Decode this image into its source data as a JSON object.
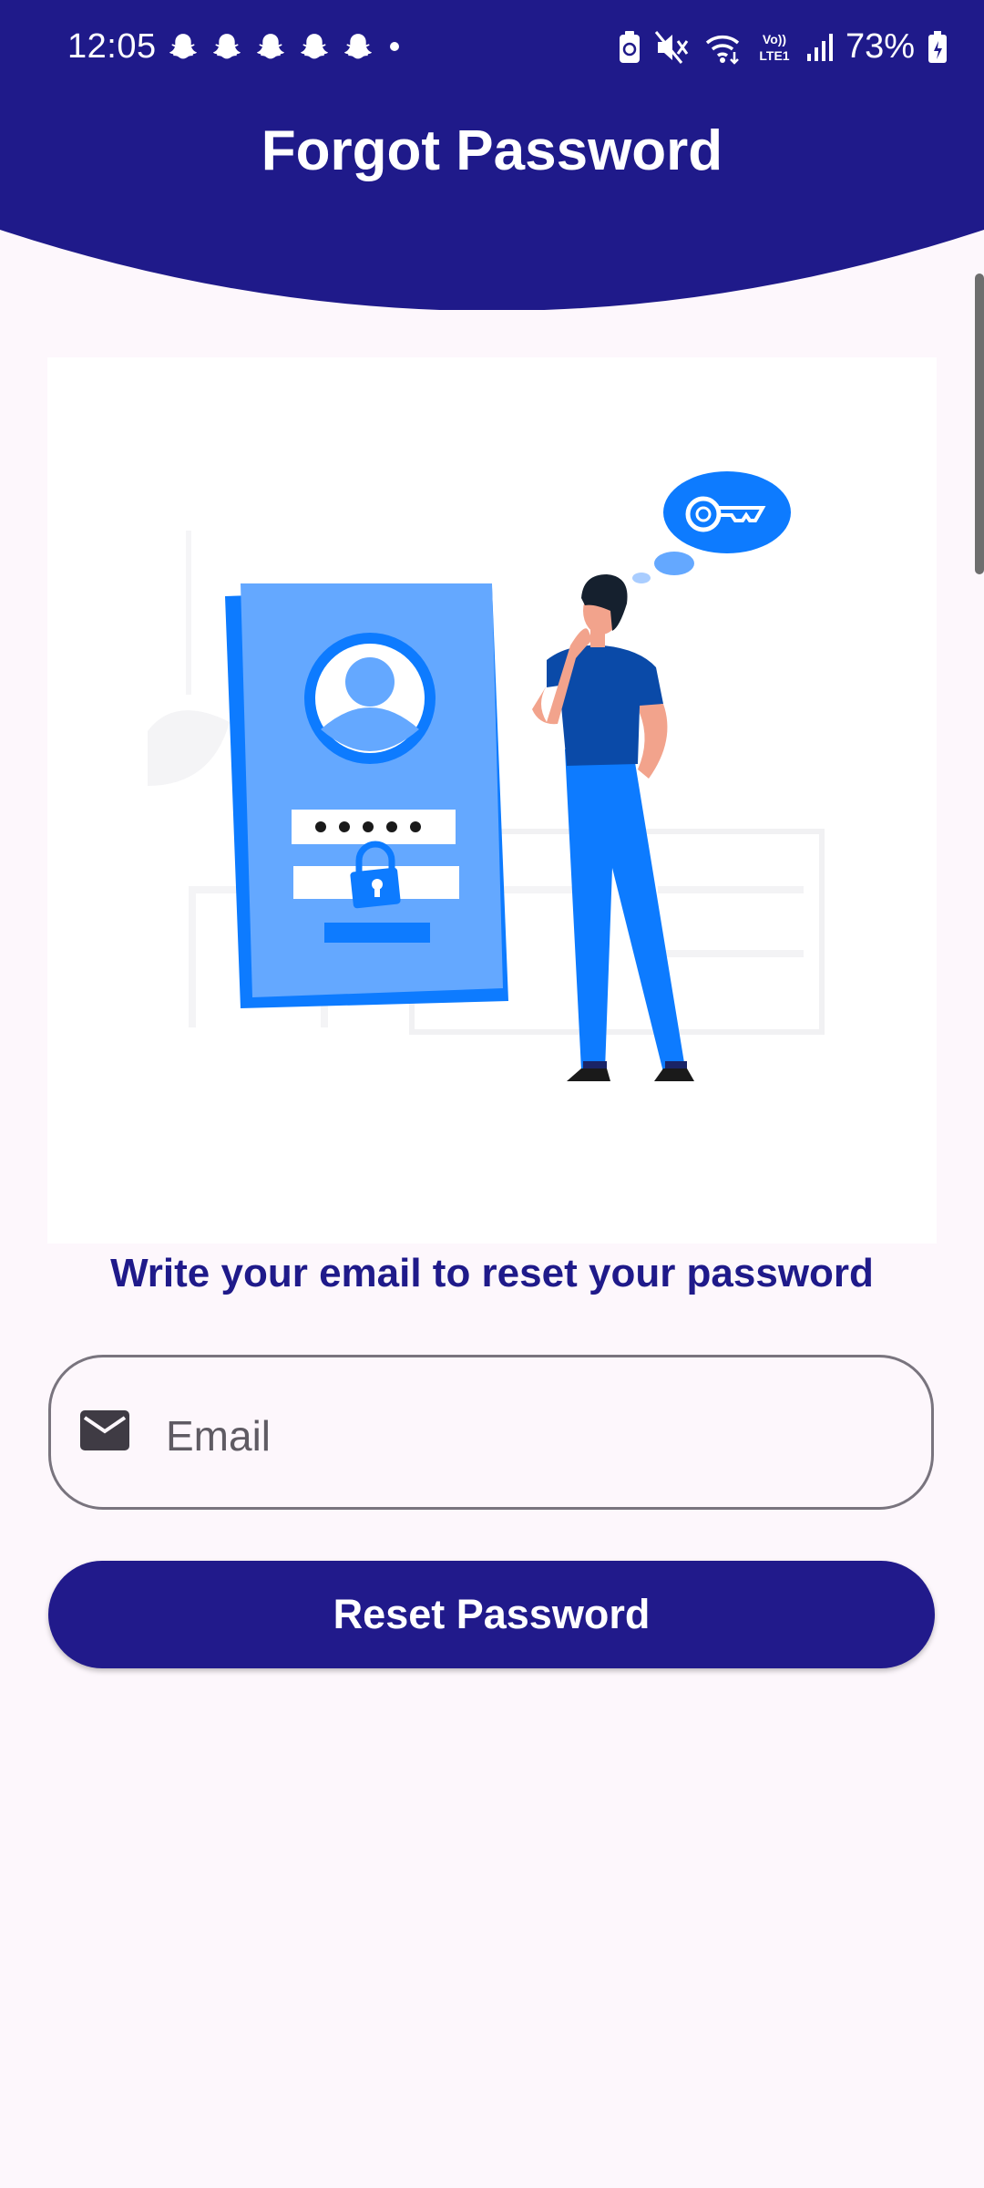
{
  "status_bar": {
    "time": "12:05",
    "battery": "73%",
    "icons": [
      "snapchat-icon",
      "snapchat-icon",
      "snapchat-icon",
      "snapchat-icon",
      "snapchat-icon",
      "notification-dot",
      "battery-saver-icon",
      "mute-icon",
      "wifi-icon",
      "volte-icon",
      "signal-icon",
      "battery-icon"
    ]
  },
  "header": {
    "title": "Forgot Password",
    "color": "#1f1a8a"
  },
  "illustration": {
    "description_icon": "person-thinking-key-illustration",
    "password_dots": "•••••"
  },
  "form": {
    "subtitle": "Write your email to reset your password",
    "email_placeholder": "Email",
    "email_value": "",
    "submit_label": "Reset Password"
  },
  "colors": {
    "primary": "#211a8b",
    "accent_blue": "#0d7bff",
    "light_blue": "#64a8ff",
    "background": "#fdf7fc"
  }
}
